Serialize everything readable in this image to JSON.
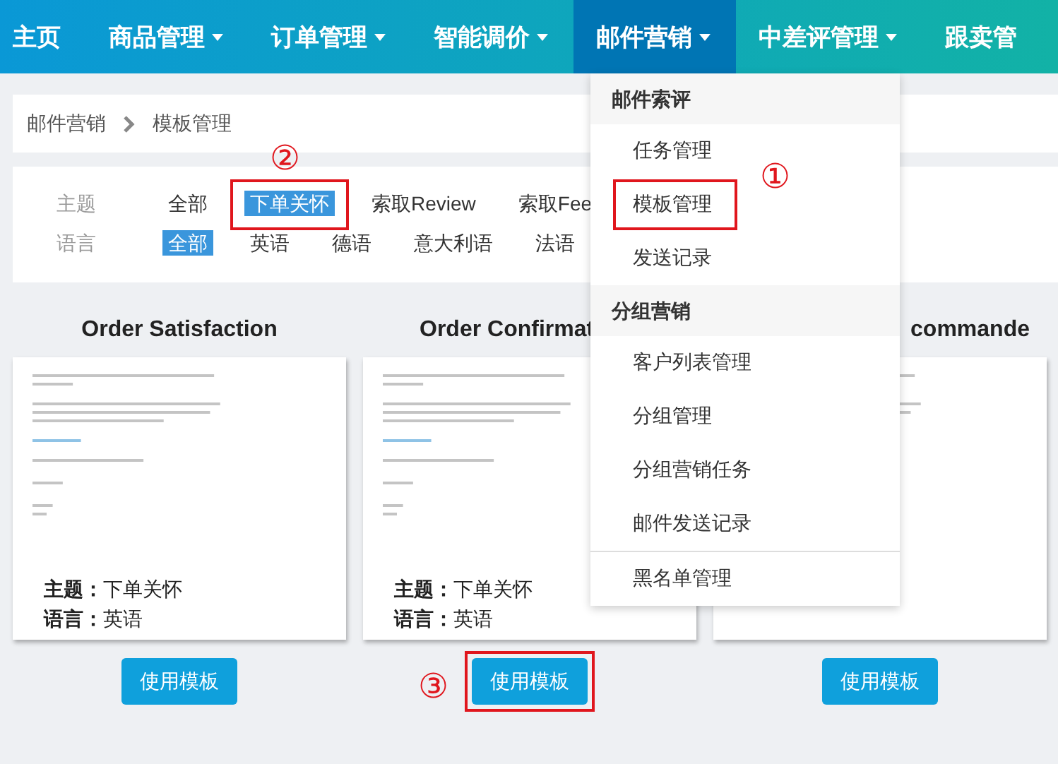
{
  "nav": [
    {
      "label": "主页",
      "dropdown": false,
      "selected": false
    },
    {
      "label": "商品管理",
      "dropdown": true,
      "selected": false
    },
    {
      "label": "订单管理",
      "dropdown": true,
      "selected": false
    },
    {
      "label": "智能调价",
      "dropdown": true,
      "selected": false
    },
    {
      "label": "邮件营销",
      "dropdown": true,
      "selected": true
    },
    {
      "label": "中差评管理",
      "dropdown": true,
      "selected": false
    },
    {
      "label": "跟卖管",
      "dropdown": false,
      "selected": false
    }
  ],
  "breadcrumb": [
    "邮件营销",
    "模板管理"
  ],
  "filters": [
    {
      "label": "主题",
      "options": [
        {
          "text": "全部",
          "selected": false
        },
        {
          "text": "下单关怀",
          "selected": true,
          "callout": "②"
        },
        {
          "text": "索取Review",
          "selected": false
        },
        {
          "text": "索取Fee",
          "selected": false
        }
      ]
    },
    {
      "label": "语言",
      "options": [
        {
          "text": "全部",
          "selected": true
        },
        {
          "text": "英语",
          "selected": false
        },
        {
          "text": "德语",
          "selected": false
        },
        {
          "text": "意大利语",
          "selected": false
        },
        {
          "text": "法语",
          "selected": false
        }
      ]
    }
  ],
  "cards": [
    {
      "title": "Order Satisfaction",
      "meta": [
        "**主题：**下单关怀",
        "**语言：**英语"
      ],
      "button": {
        "label": "使用模板"
      }
    },
    {
      "title": "Order Confirmat",
      "meta": [
        "**主题：**下单关怀",
        "**语言：**英语"
      ],
      "button": {
        "label": "使用模板",
        "callout": "③"
      }
    },
    {
      "title": "commande",
      "button": {
        "label": "使用模板"
      }
    }
  ],
  "dropdown": {
    "groups": [
      {
        "header": "邮件索评",
        "items": [
          {
            "label": "任务管理"
          },
          {
            "label": "模板管理",
            "callout": "①"
          },
          {
            "label": "发送记录"
          }
        ]
      },
      {
        "header": "分组营销",
        "items": [
          {
            "label": "客户列表管理"
          },
          {
            "label": "分组管理"
          },
          {
            "label": "分组营销任务"
          },
          {
            "label": "邮件发送记录"
          }
        ]
      },
      {
        "items": [
          {
            "label": "黑名单管理"
          }
        ]
      }
    ]
  }
}
